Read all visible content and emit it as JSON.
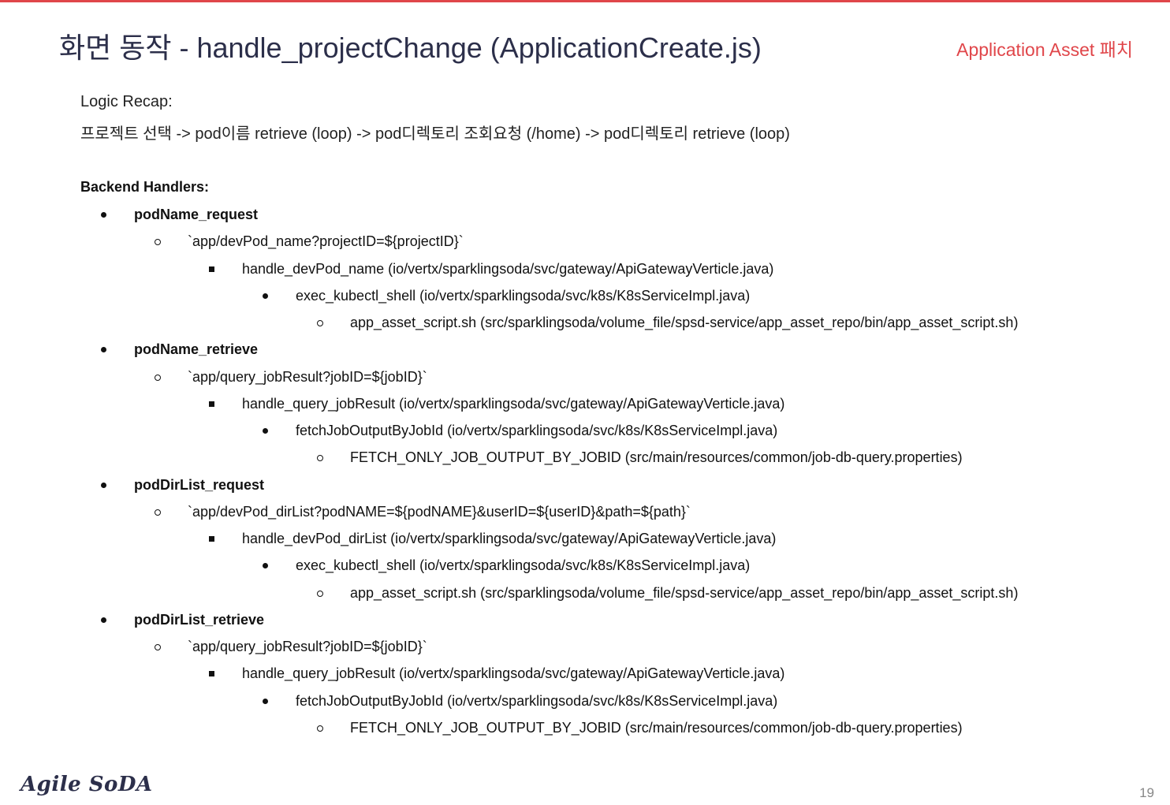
{
  "slide": {
    "title": "화면 동작 - handle_projectChange  (ApplicationCreate.js)",
    "tag": "Application Asset 패치",
    "recap_label": "Logic Recap:",
    "recap_flow": "프로젝트 선택 -> pod이름 retrieve (loop) -> pod디렉토리 조회요청 (/home) -> pod디렉토리 retrieve (loop)",
    "backend_label": "Backend Handlers:",
    "logo": "Agile SoDA",
    "page_number": "19",
    "accent_color": "#e0464a"
  },
  "handlers": [
    {
      "level": 1,
      "text": "podName_request"
    },
    {
      "level": 2,
      "text": "`app/devPod_name?projectID=${projectID}`"
    },
    {
      "level": 3,
      "text": "handle_devPod_name  (io/vertx/sparklingsoda/svc/gateway/ApiGatewayVerticle.java)"
    },
    {
      "level": 4,
      "text": "exec_kubectl_shell (io/vertx/sparklingsoda/svc/k8s/K8sServiceImpl.java)"
    },
    {
      "level": 5,
      "text": "app_asset_script.sh (src/sparklingsoda/volume_file/spsd-service/app_asset_repo/bin/app_asset_script.sh)"
    },
    {
      "level": 1,
      "text": "podName_retrieve"
    },
    {
      "level": 2,
      "text": "`app/query_jobResult?jobID=${jobID}`"
    },
    {
      "level": 3,
      "text": "handle_query_jobResult  (io/vertx/sparklingsoda/svc/gateway/ApiGatewayVerticle.java)"
    },
    {
      "level": 4,
      "text": "fetchJobOutputByJobId  (io/vertx/sparklingsoda/svc/k8s/K8sServiceImpl.java)"
    },
    {
      "level": 5,
      "text": "FETCH_ONLY_JOB_OUTPUT_BY_JOBID  (src/main/resources/common/job-db-query.properties)"
    },
    {
      "level": 1,
      "text": "podDirList_request"
    },
    {
      "level": 2,
      "text": "`app/devPod_dirList?podNAME=${podNAME}&userID=${userID}&path=${path}`"
    },
    {
      "level": 3,
      "text": "handle_devPod_dirList  (io/vertx/sparklingsoda/svc/gateway/ApiGatewayVerticle.java)"
    },
    {
      "level": 4,
      "text": "exec_kubectl_shell (io/vertx/sparklingsoda/svc/k8s/K8sServiceImpl.java)"
    },
    {
      "level": 5,
      "text": "app_asset_script.sh (src/sparklingsoda/volume_file/spsd-service/app_asset_repo/bin/app_asset_script.sh)"
    },
    {
      "level": 1,
      "text": "podDirList_retrieve"
    },
    {
      "level": 2,
      "text": "`app/query_jobResult?jobID=${jobID}`"
    },
    {
      "level": 3,
      "text": "handle_query_jobResult  (io/vertx/sparklingsoda/svc/gateway/ApiGatewayVerticle.java)"
    },
    {
      "level": 4,
      "text": "fetchJobOutputByJobId  (io/vertx/sparklingsoda/svc/k8s/K8sServiceImpl.java)"
    },
    {
      "level": 5,
      "text": "FETCH_ONLY_JOB_OUTPUT_BY_JOBID  (src/main/resources/common/job-db-query.properties)"
    }
  ]
}
